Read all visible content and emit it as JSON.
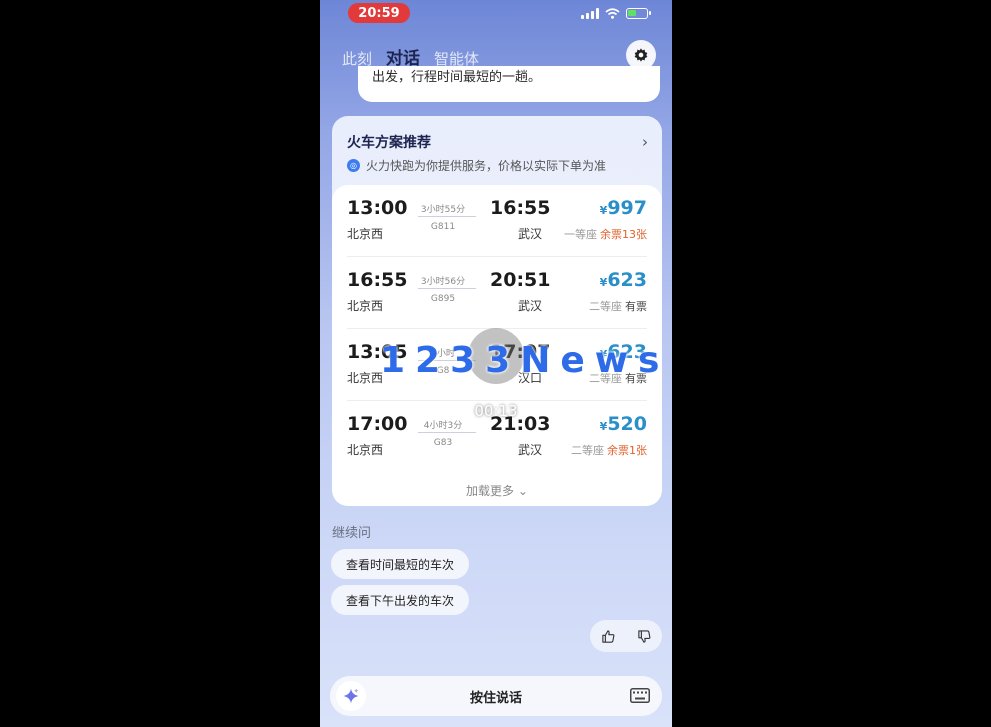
{
  "status_bar": {
    "time": "20:59"
  },
  "tabs": [
    {
      "label": "此刻",
      "active": false
    },
    {
      "label": "对话",
      "active": true
    },
    {
      "label": "智能体",
      "active": false
    }
  ],
  "prev_message": "出发，行程时间最短的一趟。",
  "card": {
    "title": "火车方案推荐",
    "notice": "火力快跑为你提供服务，价格以实际下单为准",
    "load_more": "加载更多",
    "trains": [
      {
        "dep_time": "13:00",
        "dep_station": "北京西",
        "duration": "3小时55分",
        "train_no": "G811",
        "arr_time": "16:55",
        "arr_station": "武汉",
        "currency": "¥",
        "price": "997",
        "seat": "一等座",
        "availability": "余票13张",
        "warn": true
      },
      {
        "dep_time": "16:55",
        "dep_station": "北京西",
        "duration": "3小时56分",
        "train_no": "G895",
        "arr_time": "20:51",
        "arr_station": "武汉",
        "currency": "¥",
        "price": "623",
        "seat": "二等座",
        "availability": "有票",
        "warn": false
      },
      {
        "dep_time": "13:05",
        "dep_station": "北京西",
        "duration": "4小时",
        "train_no": "G8",
        "arr_time": "17:07",
        "arr_station": "汉口",
        "currency": "¥",
        "price": "623",
        "seat": "二等座",
        "availability": "有票",
        "warn": false
      },
      {
        "dep_time": "17:00",
        "dep_station": "北京西",
        "duration": "4小时3分",
        "train_no": "G83",
        "arr_time": "21:03",
        "arr_station": "武汉",
        "currency": "¥",
        "price": "520",
        "seat": "二等座",
        "availability": "余票1张",
        "warn": true
      }
    ]
  },
  "followup": {
    "label": "继续问",
    "chips": [
      "查看时间最短的车次",
      "查看下午出发的车次"
    ]
  },
  "input_bar": {
    "hold_to_talk": "按住说话"
  },
  "overlay": {
    "watermark": "1233News",
    "timer": "00:13"
  },
  "colors": {
    "price": "#2a8fc9",
    "warn": "#e0612b",
    "status_pill": "#e23a3a"
  }
}
